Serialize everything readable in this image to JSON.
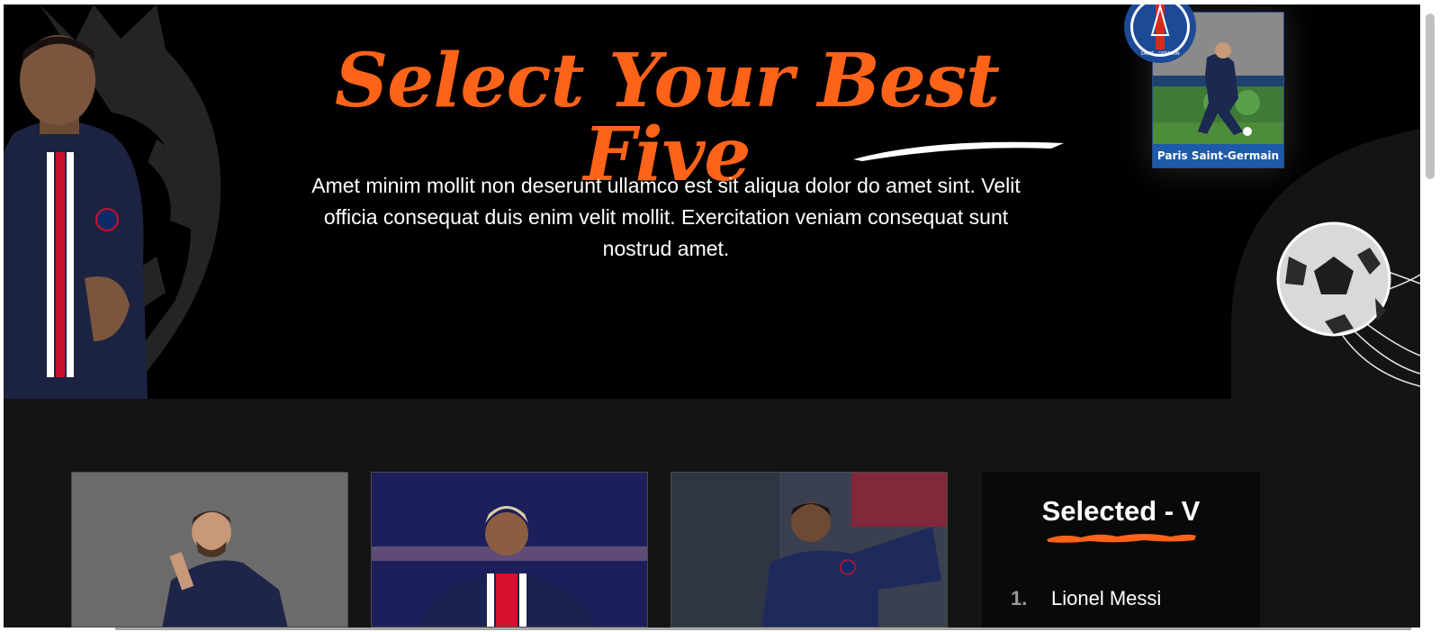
{
  "hero": {
    "title": "Select Your Best Five",
    "description": "Amet minim mollit non deserunt ullamco est sit aliqua dolor do amet sint. Velit officia consequat duis enim velit mollit. Exercitation veniam consequat sunt nostrud amet."
  },
  "club_card": {
    "caption": "Paris Saint-Germain",
    "badge_text": "SAINT · GERMAIN"
  },
  "players": [
    {
      "image": "player-card-1"
    },
    {
      "image": "player-card-2"
    },
    {
      "image": "player-card-3"
    }
  ],
  "selected": {
    "title": "Selected - V",
    "items": [
      {
        "number": "1.",
        "name": "Lionel Messi"
      }
    ]
  },
  "colors": {
    "accent": "#ff6319",
    "hero_background": "#000000",
    "section_background": "#141414",
    "panel_background": "#090909",
    "club_blue": "#1d5aa8"
  }
}
